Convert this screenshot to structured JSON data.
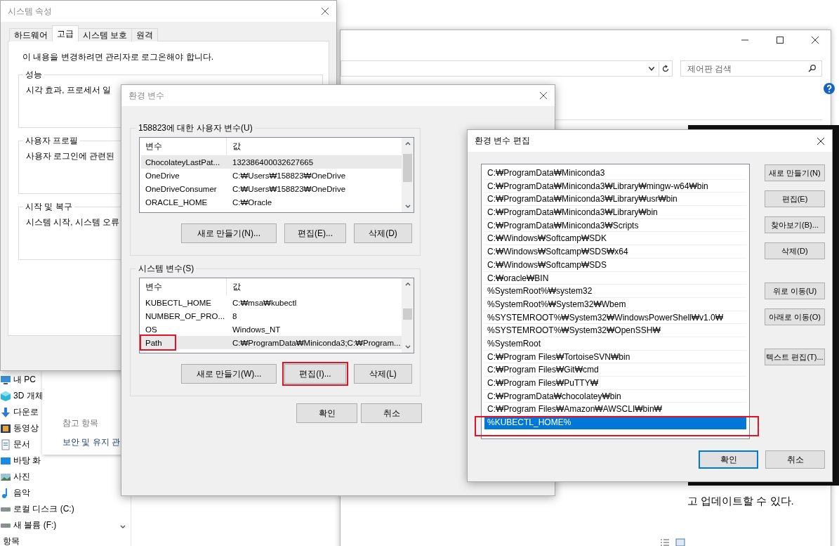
{
  "control_panel": {
    "search": {
      "placeholder": "제어판 검색"
    },
    "body_text": "고 업데이트할 수 있다."
  },
  "explorer": {
    "nav_items": [
      {
        "label": "내 PC",
        "kind": "pc"
      },
      {
        "label": "3D 개체",
        "kind": "cube"
      },
      {
        "label": "다운로",
        "kind": "download"
      },
      {
        "label": "동영상",
        "kind": "video"
      },
      {
        "label": "문서",
        "kind": "document"
      },
      {
        "label": "바탕 화",
        "kind": "desktop"
      },
      {
        "label": "사진",
        "kind": "photos"
      },
      {
        "label": "음악",
        "kind": "music"
      },
      {
        "label": "로컬 디스크 (C:)",
        "kind": "drive"
      },
      {
        "label": "새 볼륨 (F:)",
        "kind": "drive"
      }
    ],
    "status": "항목",
    "see_also": {
      "heading": "참고 항목",
      "link": "보안 및 유지 관"
    }
  },
  "system_properties": {
    "title": "시스템 속성",
    "tabs": [
      {
        "label": "하드웨어",
        "selected": false
      },
      {
        "label": "고급",
        "selected": true
      },
      {
        "label": "시스템 보호",
        "selected": false
      },
      {
        "label": "원격",
        "selected": false
      }
    ],
    "notice": "이 내용을 변경하려면 관리자로 로그온해야 합니다.",
    "groups": [
      {
        "title": "성능",
        "text": "시각 효과, 프로세서 일"
      },
      {
        "title": "사용자 프로필",
        "text": "사용자 로그인에 관련된"
      },
      {
        "title": "시작 및 복구",
        "text": "시스템 시작, 시스템 오류"
      }
    ]
  },
  "environment_variables": {
    "title": "환경 변수",
    "user_section": {
      "title": "158823에 대한 사용자 변수(U)",
      "columns": [
        "변수",
        "값"
      ],
      "rows": [
        {
          "name": "ChocolateyLastPat...",
          "value": "132386400032627665",
          "selected": true,
          "highlighted": false
        },
        {
          "name": "OneDrive",
          "value": "C:₩Users₩158823₩OneDrive",
          "selected": false,
          "highlighted": false
        },
        {
          "name": "OneDriveConsumer",
          "value": "C:₩Users₩158823₩OneDrive",
          "selected": false,
          "highlighted": false
        },
        {
          "name": "ORACLE_HOME",
          "value": "C:₩Oracle",
          "selected": false,
          "highlighted": false
        }
      ],
      "buttons": [
        {
          "label": "새로 만들기(N)...",
          "highlighted": false
        },
        {
          "label": "편집(E)...",
          "highlighted": false
        },
        {
          "label": "삭제(D)",
          "highlighted": false
        }
      ]
    },
    "system_section": {
      "title": "시스템 변수(S)",
      "columns": [
        "변수",
        "값"
      ],
      "rows": [
        {
          "name": "KUBECTL_HOME",
          "value": "C:₩msa₩kubectl",
          "selected": false,
          "highlighted": false
        },
        {
          "name": "NUMBER_OF_PRO...",
          "value": "8",
          "selected": false,
          "highlighted": false
        },
        {
          "name": "OS",
          "value": "Windows_NT",
          "selected": false,
          "highlighted": false
        },
        {
          "name": "Path",
          "value": "C:₩ProgramData₩Miniconda3;C:₩Program...",
          "selected": true,
          "highlighted": true
        }
      ],
      "buttons": [
        {
          "label": "새로 만들기(W)...",
          "highlighted": false
        },
        {
          "label": "편집(I)...",
          "highlighted": true
        },
        {
          "label": "삭제(L)",
          "highlighted": false
        }
      ]
    },
    "buttons": [
      "확인",
      "취소"
    ]
  },
  "edit_dialog": {
    "title": "환경 변수 편집",
    "entries": [
      {
        "text": "C:₩ProgramData₩Miniconda3",
        "selected": false,
        "highlighted": false
      },
      {
        "text": "C:₩ProgramData₩Miniconda3₩Library₩mingw-w64₩bin",
        "selected": false,
        "highlighted": false
      },
      {
        "text": "C:₩ProgramData₩Miniconda3₩Library₩usr₩bin",
        "selected": false,
        "highlighted": false
      },
      {
        "text": "C:₩ProgramData₩Miniconda3₩Library₩bin",
        "selected": false,
        "highlighted": false
      },
      {
        "text": "C:₩ProgramData₩Miniconda3₩Scripts",
        "selected": false,
        "highlighted": false
      },
      {
        "text": "C:₩Windows₩Softcamp₩SDK",
        "selected": false,
        "highlighted": false
      },
      {
        "text": "C:₩Windows₩Softcamp₩SDS₩x64",
        "selected": false,
        "highlighted": false
      },
      {
        "text": "C:₩Windows₩Softcamp₩SDS",
        "selected": false,
        "highlighted": false
      },
      {
        "text": "C:₩oracle₩BIN",
        "selected": false,
        "highlighted": false
      },
      {
        "text": "%SystemRoot%₩system32",
        "selected": false,
        "highlighted": false
      },
      {
        "text": "%SystemRoot%₩System32₩Wbem",
        "selected": false,
        "highlighted": false
      },
      {
        "text": "%SYSTEMROOT%₩System32₩WindowsPowerShell₩v1.0₩",
        "selected": false,
        "highlighted": false
      },
      {
        "text": "%SYSTEMROOT%₩System32₩OpenSSH₩",
        "selected": false,
        "highlighted": false
      },
      {
        "text": "%SystemRoot",
        "selected": false,
        "highlighted": false
      },
      {
        "text": "C:₩Program Files₩TortoiseSVN₩bin",
        "selected": false,
        "highlighted": false
      },
      {
        "text": "C:₩Program Files₩Git₩cmd",
        "selected": false,
        "highlighted": false
      },
      {
        "text": "C:₩Program Files₩PuTTY₩",
        "selected": false,
        "highlighted": false
      },
      {
        "text": "C:₩ProgramData₩chocolatey₩bin",
        "selected": false,
        "highlighted": false
      },
      {
        "text": "C:₩Program Files₩Amazon₩AWSCLI₩bin₩",
        "selected": false,
        "highlighted": false
      },
      {
        "text": "%KUBECTL_HOME%",
        "selected": true,
        "highlighted": true
      }
    ],
    "side_button_groups": [
      [
        "새로 만들기(N)",
        "편집(E)",
        "찾아보기(B)...",
        "삭제(D)"
      ],
      [
        "위로 이동(U)",
        "아래로 이동(O)"
      ],
      [
        "텍스트 편집(T)..."
      ]
    ],
    "buttons": [
      {
        "label": "확인",
        "default": true
      },
      {
        "label": "취소",
        "default": false
      }
    ]
  }
}
